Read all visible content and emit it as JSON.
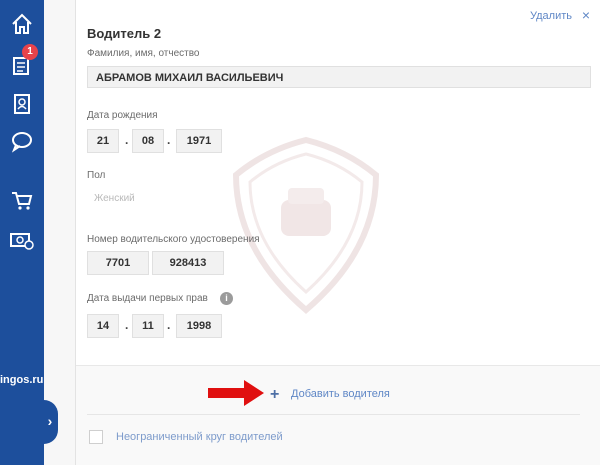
{
  "sidebar": {
    "badge": "1",
    "brand": "ingos.ru",
    "icons": [
      "home-icon",
      "documents-icon",
      "contacts-icon",
      "chat-icon",
      "cart-icon",
      "payment-icon"
    ],
    "accent": "#1d4f9c",
    "badge_color": "#e8434b"
  },
  "card": {
    "title": "Водитель 2",
    "delete_label": "Удалить",
    "delete_icon": "×",
    "name_label": "Фамилия, имя, отчество",
    "name_value": "АБРАМОВ МИХАИЛ ВАСИЛЬЕВИЧ",
    "birth_label": "Дата рождения",
    "birth": {
      "day": "21",
      "month": "08",
      "year": "1971"
    },
    "sex_label": "Пол",
    "sex_placeholder": "Женский",
    "license_label": "Номер водительского удостоверения",
    "license": {
      "series": "7701",
      "number": "928413"
    },
    "first_license_label": "Дата выдачи первых прав",
    "first_license": {
      "day": "14",
      "month": "11",
      "year": "1998"
    },
    "info_icon": "i",
    "date_separator": "."
  },
  "footer": {
    "add_driver_label": "Добавить водителя",
    "add_icon": "+",
    "unlimited_label": "Неограниченный круг водителей"
  }
}
